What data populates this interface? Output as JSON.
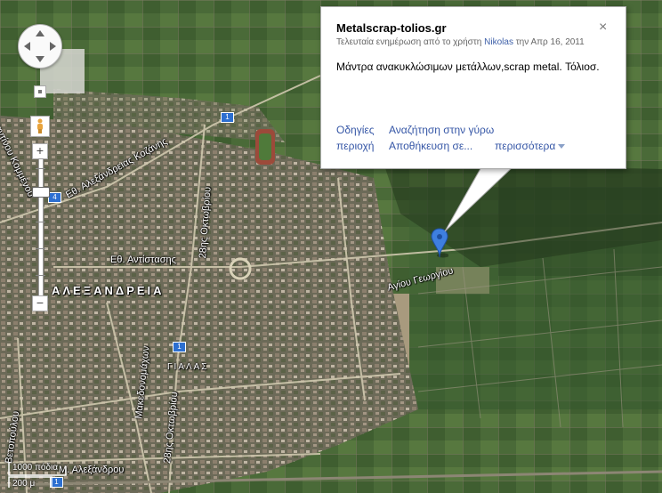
{
  "map": {
    "labels": {
      "city": "ΑΛΕΞΑΝΔΡΕΙΑ",
      "district": "ΓΙΑΛΑΣ",
      "kozanis": "Εθ. Αλεξάνδρειας Κοζάνης",
      "oktovriou_north": "28ης Οκτωβρίου",
      "oktovriou_south": "28ης Οκτωβρίου",
      "antistasis": "Εθ. Αντίστασης",
      "makedonomachon": "Μακεδονομάχων",
      "agiou_georgiou": "Αγίου Γεωργίου",
      "vetopoulou": "Βετοπούλου",
      "kommenou": "Κωνσταντίνου Κομμένου",
      "alexandrou": "Μ. Αλεξάνδρου"
    },
    "route_shields": [
      "1",
      "1",
      "4",
      "1"
    ]
  },
  "controls": {
    "zoom_in": "+",
    "zoom_out": "−",
    "zoom_level": 0.24
  },
  "scale": {
    "top": "1000 πόδια",
    "bottom": "200 μ"
  },
  "info_window": {
    "title": "Metalscrap-tolios.gr",
    "close": "×",
    "meta_prefix": "Τελευταία ενημέρωση από το χρήστη",
    "meta_user": "Nikolas",
    "meta_suffix": "την Απρ 16, 2011",
    "description": "Μάντρα ανακυκλώσιμων μετάλλων,scrap metal. Τόλιοσ.",
    "links": {
      "directions": "Οδηγίες",
      "search_nearby": "Αναζήτηση στην γύρω",
      "area": "περιοχή",
      "save": "Αποθήκευση σε...",
      "more": "περισσότερα"
    }
  },
  "colors": {
    "marker": "#3e7fe0",
    "link": "#3556a6"
  }
}
